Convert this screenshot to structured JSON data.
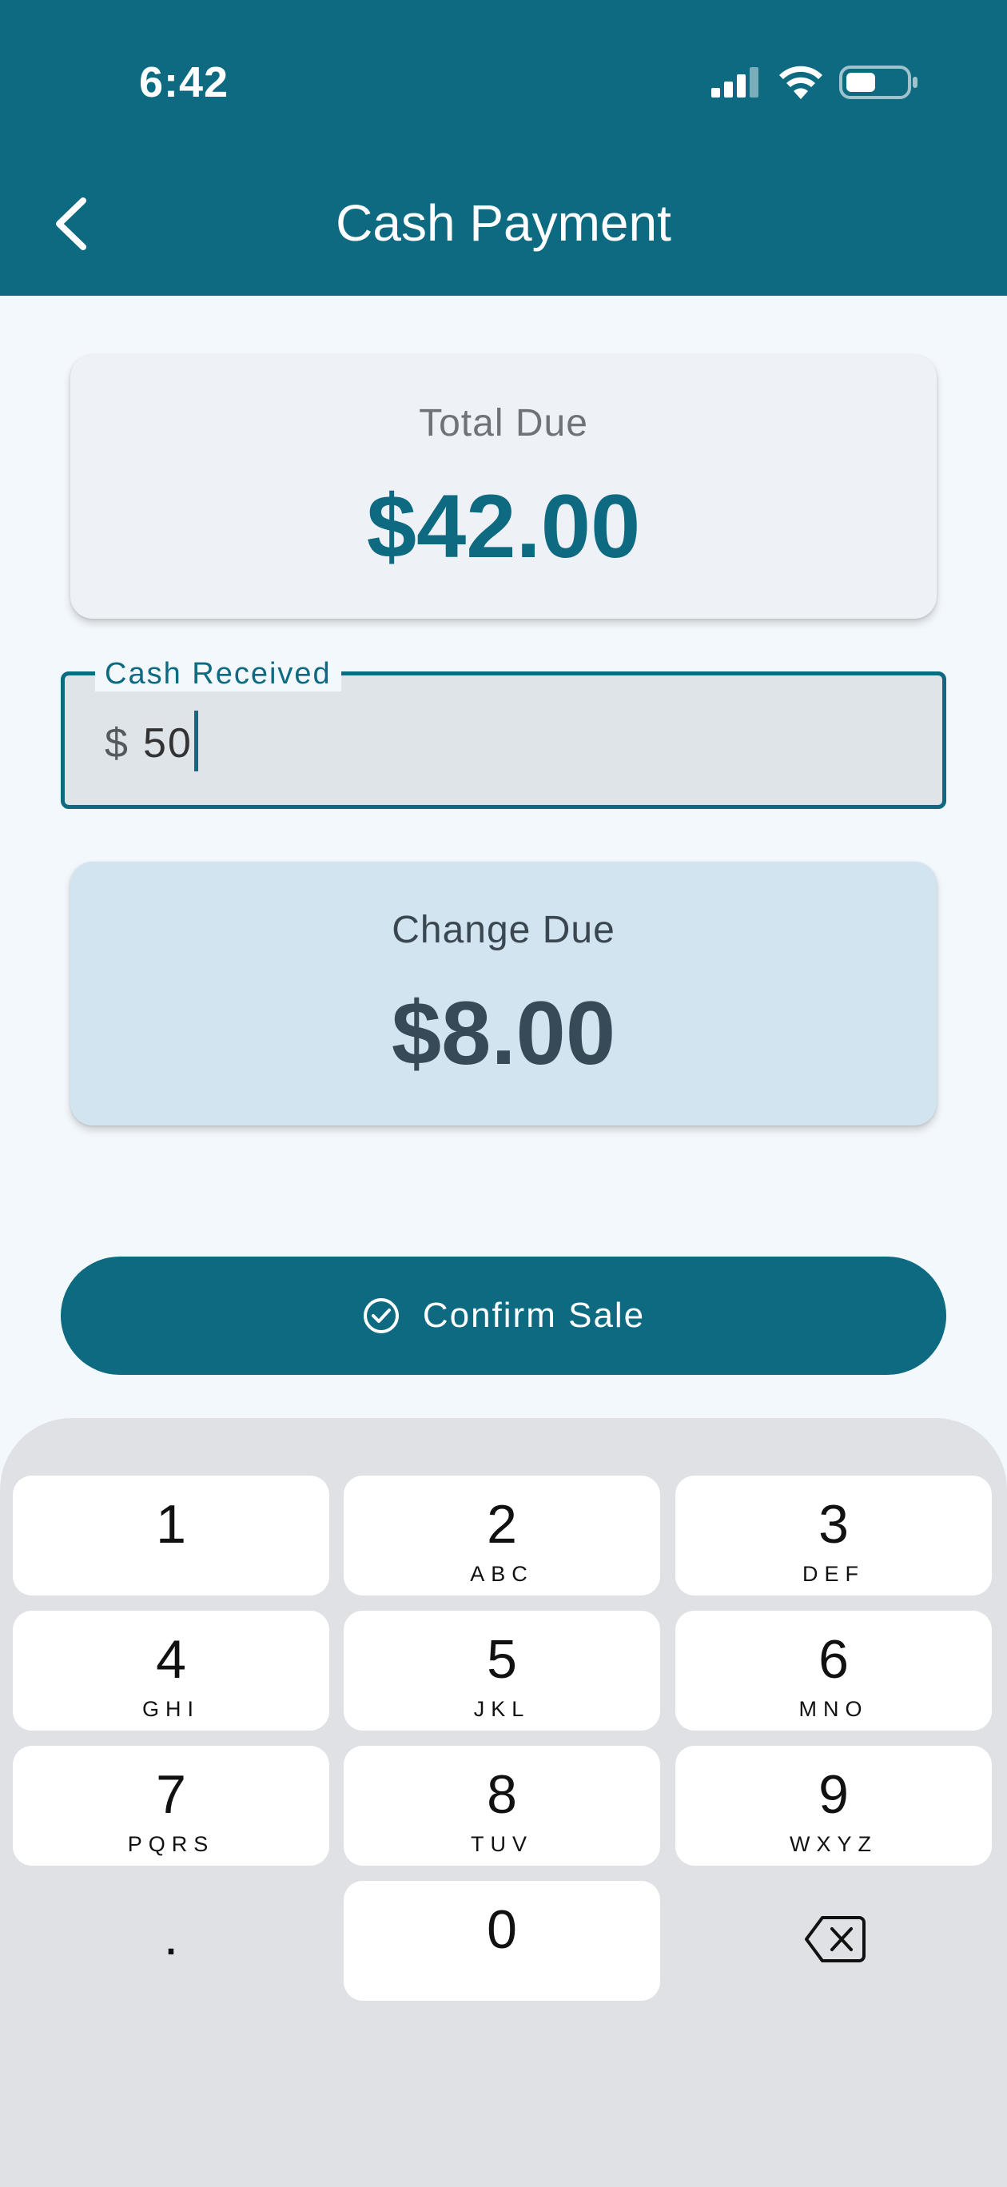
{
  "status_bar": {
    "time": "6:42",
    "icons": [
      "signal-icon",
      "wifi-icon",
      "battery-icon"
    ]
  },
  "header": {
    "back_icon": "chevron-left-icon",
    "title": "Cash Payment"
  },
  "total_card": {
    "label": "Total Due",
    "amount": "$42.00"
  },
  "cash_input": {
    "label": "Cash Received",
    "prefix": "$",
    "value": "50"
  },
  "change_card": {
    "label": "Change Due",
    "amount": "$8.00"
  },
  "confirm_button": {
    "icon": "check-circle-icon",
    "label": "Confirm Sale"
  },
  "keypad": {
    "keys": [
      {
        "digit": "1",
        "letters": ""
      },
      {
        "digit": "2",
        "letters": "ABC"
      },
      {
        "digit": "3",
        "letters": "DEF"
      },
      {
        "digit": "4",
        "letters": "GHI"
      },
      {
        "digit": "5",
        "letters": "JKL"
      },
      {
        "digit": "6",
        "letters": "MNO"
      },
      {
        "digit": "7",
        "letters": "PQRS"
      },
      {
        "digit": "8",
        "letters": "TUV"
      },
      {
        "digit": "9",
        "letters": "WXYZ"
      },
      {
        "digit": ".",
        "letters": ""
      },
      {
        "digit": "0",
        "letters": ""
      },
      {
        "digit": "",
        "letters": ""
      }
    ],
    "delete_icon": "backspace-icon"
  },
  "colors": {
    "primary": "#0d6a81",
    "background": "#f3f8fc",
    "total_card": "#eef2f6",
    "change_card": "#d1e4f0",
    "keypad_bg": "#dfe1e5"
  }
}
